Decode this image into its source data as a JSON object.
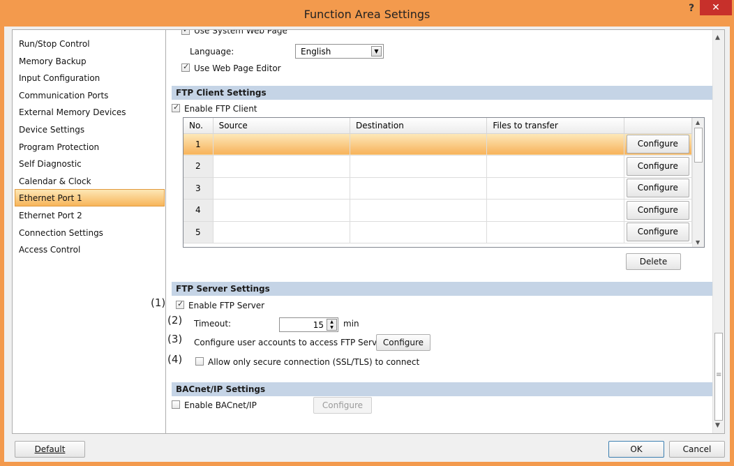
{
  "window": {
    "title": "Function Area Settings",
    "help": "?",
    "close": "✕"
  },
  "nav": {
    "items": [
      {
        "label": "Run/Stop Control"
      },
      {
        "label": "Memory Backup"
      },
      {
        "label": "Input Configuration"
      },
      {
        "label": "Communication Ports"
      },
      {
        "label": "External Memory Devices"
      },
      {
        "label": "Device Settings"
      },
      {
        "label": "Program Protection"
      },
      {
        "label": "Self Diagnostic"
      },
      {
        "label": "Calendar & Clock"
      },
      {
        "label": "Ethernet Port 1",
        "selected": true
      },
      {
        "label": "Ethernet Port 2"
      },
      {
        "label": "Connection Settings"
      },
      {
        "label": "Access Control"
      }
    ]
  },
  "web": {
    "use_system_web_page": {
      "label": "Use System Web Page",
      "checked": true
    },
    "language_label": "Language:",
    "language_value": "English",
    "use_web_page_editor": {
      "label": "Use Web Page Editor",
      "checked": true
    }
  },
  "ftp_client": {
    "section": "FTP Client Settings",
    "enable": {
      "label": "Enable FTP Client",
      "checked": true
    },
    "columns": [
      "No.",
      "Source",
      "Destination",
      "Files to transfer",
      ""
    ],
    "rows": [
      {
        "no": "1",
        "source": "",
        "destination": "",
        "files": "",
        "button": "Configure"
      },
      {
        "no": "2",
        "source": "",
        "destination": "",
        "files": "",
        "button": "Configure"
      },
      {
        "no": "3",
        "source": "",
        "destination": "",
        "files": "",
        "button": "Configure"
      },
      {
        "no": "4",
        "source": "",
        "destination": "",
        "files": "",
        "button": "Configure"
      },
      {
        "no": "5",
        "source": "",
        "destination": "",
        "files": "",
        "button": "Configure"
      }
    ],
    "delete": "Delete"
  },
  "ftp_server": {
    "section": "FTP Server Settings",
    "callouts": [
      "(1)",
      "(2)",
      "(3)",
      "(4)"
    ],
    "enable": {
      "label": "Enable FTP Server",
      "checked": true
    },
    "timeout_label": "Timeout:",
    "timeout_value": "15",
    "timeout_unit": "min",
    "accounts_label": "Configure user accounts to access FTP Server:",
    "accounts_button": "Configure",
    "secure": {
      "label": "Allow only secure connection (SSL/TLS) to connect",
      "checked": false
    }
  },
  "bacnet": {
    "section": "BACnet/IP Settings",
    "enable": {
      "label": "Enable BACnet/IP",
      "checked": false
    },
    "button": "Configure"
  },
  "footer": {
    "default": "Default",
    "ok": "OK",
    "cancel": "Cancel"
  }
}
